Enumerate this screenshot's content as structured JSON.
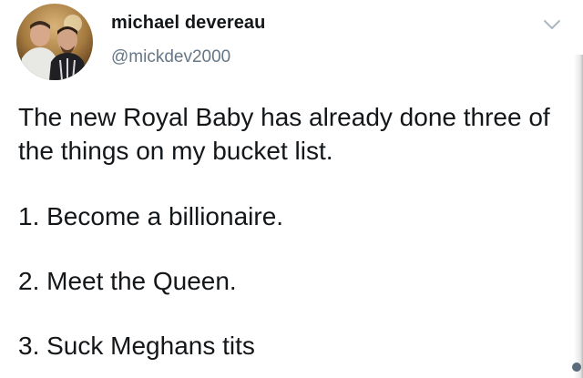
{
  "tweet": {
    "author": {
      "display_name": "michael devereau",
      "handle": "@mickdev2000",
      "avatar_icon": "profile-photo-icon"
    },
    "menu_icon": "chevron-down-icon",
    "text_line": "The new Royal Baby has already done three of the things on my bucket list.",
    "list": [
      "1. Become a billionaire.",
      "2. Meet the Queen.",
      "3. Suck Meghans tits"
    ]
  },
  "colors": {
    "text_primary": "#14171a",
    "text_secondary": "#657786",
    "background": "#ffffff",
    "chevron": "#aab8c2"
  }
}
